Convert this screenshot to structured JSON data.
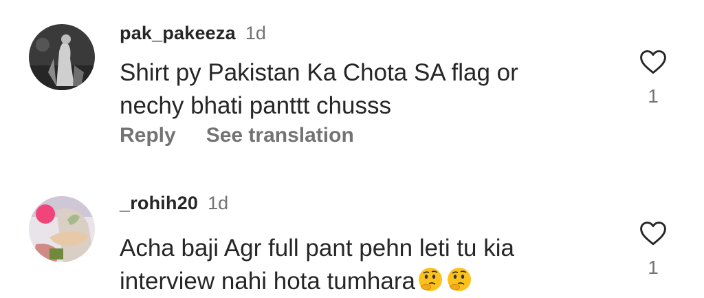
{
  "comments": [
    {
      "username": "pak_pakeeza",
      "time": "1d",
      "text": "Shirt py Pakistan Ka Chota SA flag or\nnechy bhati panttt chusss",
      "reply_label": "Reply",
      "translate_label": "See translation",
      "like_count": "1",
      "like_icon": "heart-outline-icon"
    },
    {
      "username": "_rohih20",
      "time": "1d",
      "text": "Acha baji Agr full pant pehn leti tu kia\ninterview nahi hota tumhara",
      "emojis": [
        "thinking-face",
        "thinking-face"
      ],
      "like_count": "1",
      "like_icon": "heart-outline-icon"
    }
  ],
  "colors": {
    "primary_text": "#262626",
    "secondary_text": "#737373",
    "background": "#ffffff"
  }
}
